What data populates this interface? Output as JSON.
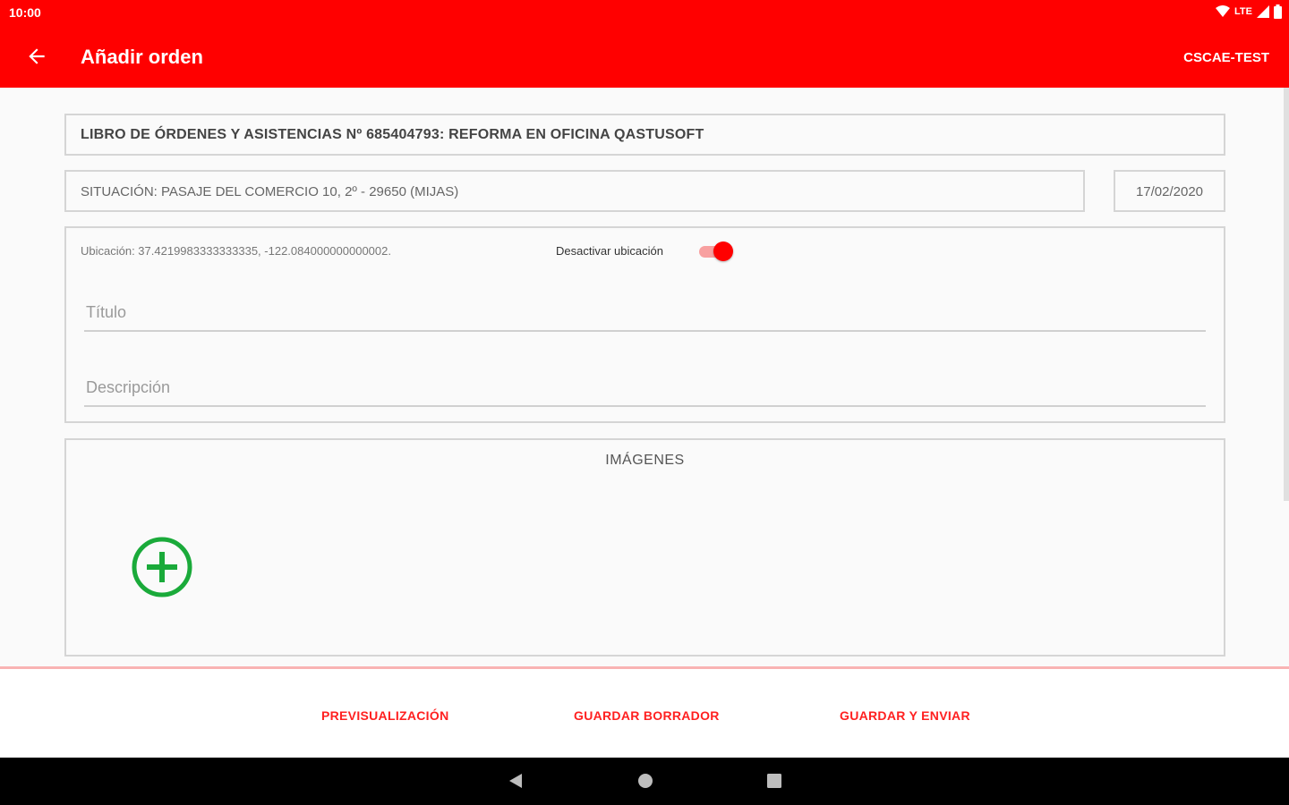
{
  "status_bar": {
    "time": "10:00",
    "network": "LTE",
    "icons": [
      "wifi-icon",
      "signal-icon",
      "battery-icon"
    ]
  },
  "app_bar": {
    "back_icon": "arrow-left-icon",
    "title": "Añadir orden",
    "action": "CSCAE-TEST",
    "background": "#ff0000"
  },
  "form": {
    "book_title": "LIBRO DE ÓRDENES Y ASISTENCIAS Nº 685404793: REFORMA EN OFICINA QASTUSOFT",
    "situacion": "SITUACIÓN: PASAJE DEL COMERCIO 10, 2º - 29650 (MIJAS)",
    "fecha": "17/02/2020",
    "ubicacion": "Ubicación: 37.4219983333333335, -122.084000000000002.",
    "desactivar_label": "Desactivar ubicación",
    "location_toggle_on": true,
    "titulo_placeholder": "Título",
    "descripcion_placeholder": "Descripción"
  },
  "images": {
    "label": "IMÁGENES",
    "add_icon": "plus-circle-icon",
    "add_color": "#1aaa3a"
  },
  "bottom_actions": {
    "preview": "PREVISUALIZACIÓN",
    "save_draft": "GUARDAR BORRADOR",
    "save_send": "GUARDAR Y ENVIAR",
    "color": "#ff2020"
  },
  "nav_bar": {
    "icons": [
      "nav-back-icon",
      "nav-home-icon",
      "nav-recents-icon"
    ]
  }
}
